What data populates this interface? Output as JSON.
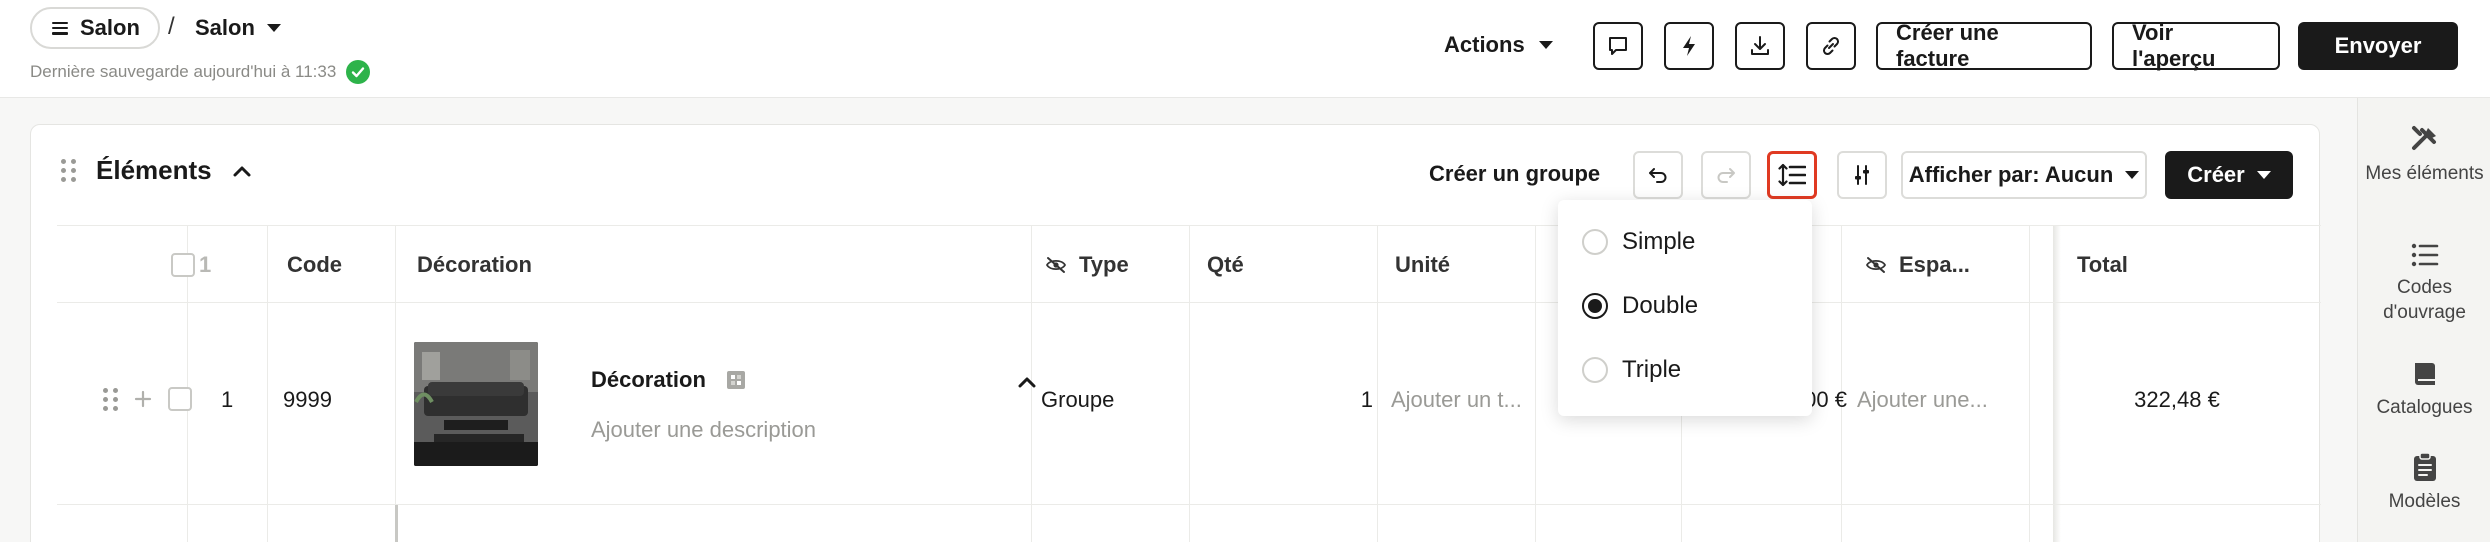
{
  "header": {
    "breadcrumb_root": "Salon",
    "breadcrumb_current": "Salon",
    "save_status": "Dernière sauvegarde aujourd'hui à 11:33",
    "actions_label": "Actions",
    "create_invoice_label": "Créer une facture",
    "preview_label": "Voir l'aperçu",
    "send_label": "Envoyer"
  },
  "toolbar": {
    "section_title": "Éléments",
    "create_group_label": "Créer un groupe",
    "display_by_label": "Afficher par: Aucun",
    "create_label": "Créer"
  },
  "table": {
    "columns": {
      "index": "1",
      "code": "Code",
      "decoration": "Décoration",
      "type": "Type",
      "qty": "Qté",
      "unit": "Unité",
      "space": "Espa...",
      "total": "Total"
    },
    "rows": [
      {
        "index": "1",
        "code": "9999",
        "title": "Décoration",
        "description_placeholder": "Ajouter une description",
        "type": "Groupe",
        "qty": "1",
        "unit_placeholder": "Ajouter un t...",
        "price_partial": "00 €",
        "space_placeholder": "Ajouter une...",
        "total": "322,48 €"
      }
    ]
  },
  "spacing_menu": {
    "options": [
      "Simple",
      "Double",
      "Triple"
    ],
    "selected": "Double"
  },
  "sidebar": {
    "items": [
      {
        "label": "Mes éléments",
        "icon": "tools-icon"
      },
      {
        "label": "Codes d'ouvrage",
        "icon": "list-icon"
      },
      {
        "label": "Catalogues",
        "icon": "book-icon"
      },
      {
        "label": "Modèles",
        "icon": "clipboard-icon"
      }
    ]
  },
  "colors": {
    "accent": "#1a1a1a",
    "success": "#2db34a",
    "highlight": "#e03a22"
  }
}
